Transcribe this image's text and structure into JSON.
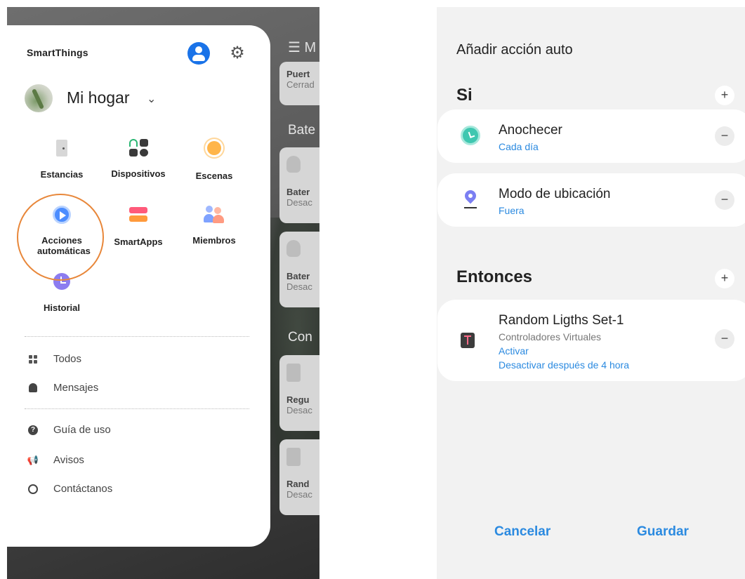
{
  "left": {
    "brand": "SmartThings",
    "home_name": "Mi hogar",
    "grid": [
      {
        "label": "Estancias"
      },
      {
        "label": "Dispositivos"
      },
      {
        "label": "Escenas"
      },
      {
        "label": "Acciones automáticas"
      },
      {
        "label": "SmartApps"
      },
      {
        "label": "Miembros"
      },
      {
        "label": "Historial"
      }
    ],
    "menu": [
      {
        "label": "Todos"
      },
      {
        "label": "Mensajes"
      },
      {
        "label": "Guía de uso"
      },
      {
        "label": "Avisos"
      },
      {
        "label": "Contáctanos"
      }
    ],
    "background": {
      "header_fragment": "☰ M",
      "card1": {
        "title": "Puert",
        "subtitle": "Cerrad"
      },
      "section1": "Bate",
      "card2": {
        "title": "Bater",
        "subtitle": "Desac"
      },
      "card3": {
        "title": "Bater",
        "subtitle": "Desac"
      },
      "section2": "Con",
      "card4": {
        "title": "Regu",
        "subtitle": "Desac"
      },
      "card5": {
        "title": "Rand",
        "subtitle": "Desac"
      }
    }
  },
  "right": {
    "title": "Añadir acción auto",
    "if_section": "Si",
    "then_section": "Entonces",
    "conditions": [
      {
        "title": "Anochecer",
        "subtitle": "Cada día",
        "icon": "clock-icon"
      },
      {
        "title": "Modo de ubicación",
        "subtitle": "Fuera",
        "icon": "location-pin-icon"
      }
    ],
    "action": {
      "title": "Random Ligths Set-1",
      "device_type": "Controladores Virtuales",
      "state": "Activar",
      "detail": "Desactivar después de 4 hora"
    },
    "cancel_label": "Cancelar",
    "save_label": "Guardar",
    "plus_symbol": "+",
    "minus_symbol": "−"
  },
  "colors": {
    "accent_blue": "#2b8ae0",
    "highlight_ring": "#e8873a"
  }
}
